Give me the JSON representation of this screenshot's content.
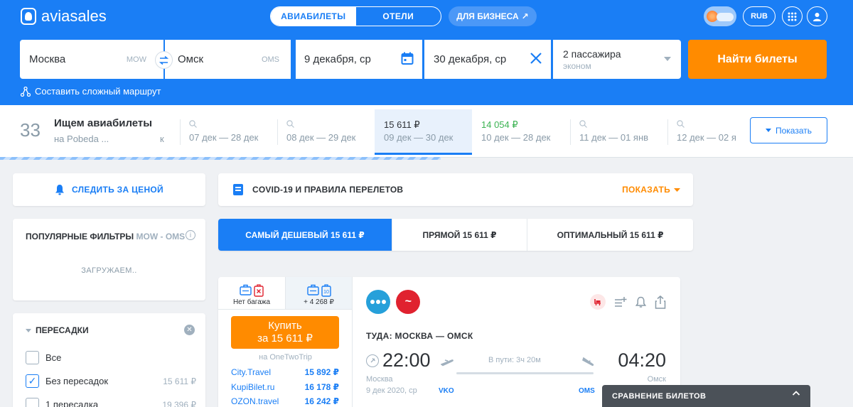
{
  "header": {
    "logo_text": "aviasales",
    "tabs": [
      {
        "label": "АВИАБИЛЕТЫ",
        "active": true
      },
      {
        "label": "ОТЕЛИ",
        "active": false
      }
    ],
    "business_label": "ДЛЯ БИЗНЕСА",
    "business_arrow": "↗",
    "currency": "RUB"
  },
  "search": {
    "origin": "Москва",
    "origin_code": "MOW",
    "destination": "Омск",
    "destination_code": "OMS",
    "depart_date": "9 декабря, ср",
    "return_date": "30 декабря, ср",
    "passengers": "2 пассажира",
    "cabin": "эконом",
    "submit_label": "Найти билеты",
    "complex_route_label": "Составить сложный маршрут"
  },
  "calendar": {
    "count": "33",
    "title": "Ищем авиабилеты",
    "subtitle": "на Pobeda ...",
    "subtitle_tail": "к",
    "cells": [
      {
        "price": "",
        "dates": "07 дек — 28 дек",
        "selected": false,
        "green": false
      },
      {
        "price": "",
        "dates": "08 дек — 29 дек",
        "selected": false,
        "green": false
      },
      {
        "price": "15 611 ₽",
        "dates": "09 дек — 30 дек",
        "selected": true,
        "green": false
      },
      {
        "price": "14 054 ₽",
        "dates": "10 дек — 28 дек",
        "selected": false,
        "green": true
      },
      {
        "price": "",
        "dates": "11 дек — 01 янв",
        "selected": false,
        "green": false
      },
      {
        "price": "",
        "dates": "12 дек — 02 я",
        "selected": false,
        "green": false
      }
    ],
    "show_label": "Показать"
  },
  "sidebar": {
    "watch_label": "СЛЕДИТЬ ЗА ЦЕНОЙ",
    "popular_title": "ПОПУЛЯРНЫЕ ФИЛЬТРЫ",
    "popular_route": "MOW - OMS",
    "loading_label": "ЗАГРУЖАЕМ..",
    "stops_title": "ПЕРЕСАДКИ",
    "stops": [
      {
        "label": "Все",
        "price": "",
        "checked": false
      },
      {
        "label": "Без пересадок",
        "price": "15 611 ₽",
        "checked": true
      },
      {
        "label": "1 пересадка",
        "price": "19 396 ₽",
        "checked": false
      }
    ]
  },
  "covid": {
    "title": "COVID-19 И ПРАВИЛА ПЕРЕЛЕТОВ",
    "action": "ПОКАЗАТЬ"
  },
  "sort_tabs": [
    {
      "label": "САМЫЙ ДЕШЕВЫЙ 15 611 ₽",
      "active": true
    },
    {
      "label": "ПРЯМОЙ 15 611 ₽",
      "active": false
    },
    {
      "label": "ОПТИМАЛЬНЫЙ 15 611 ₽",
      "active": false
    }
  ],
  "ticket": {
    "bag_options": [
      {
        "label": "Нет багажа",
        "badge": "10"
      },
      {
        "label": "+ 4 268 ₽",
        "badge": "10"
      }
    ],
    "buy_line1": "Купить",
    "buy_line2": "за 15 611 ₽",
    "via": "на OneTwoTrip",
    "agents": [
      {
        "name": "City.Travel",
        "price": "15 892 ₽"
      },
      {
        "name": "KupiBilet.ru",
        "price": "16 178 ₽"
      },
      {
        "name": "OZON.travel",
        "price": "16 242 ₽"
      }
    ],
    "route_title": "ТУДА: МОСКВА — ОМСК",
    "dep_time": "22:00",
    "arr_time": "04:20",
    "duration": "В пути: 3ч 20м",
    "dep_city": "Москва",
    "dep_date": "9 дек 2020, ср",
    "arr_city": "Омск",
    "dep_code": "VKO",
    "arr_code": "OMS"
  },
  "compare": {
    "label": "СРАВНЕНИЕ БИЛЕТОВ"
  },
  "colors": {
    "primary": "#1a7ef5",
    "accent": "#ff8b00",
    "green": "#3cb353"
  }
}
